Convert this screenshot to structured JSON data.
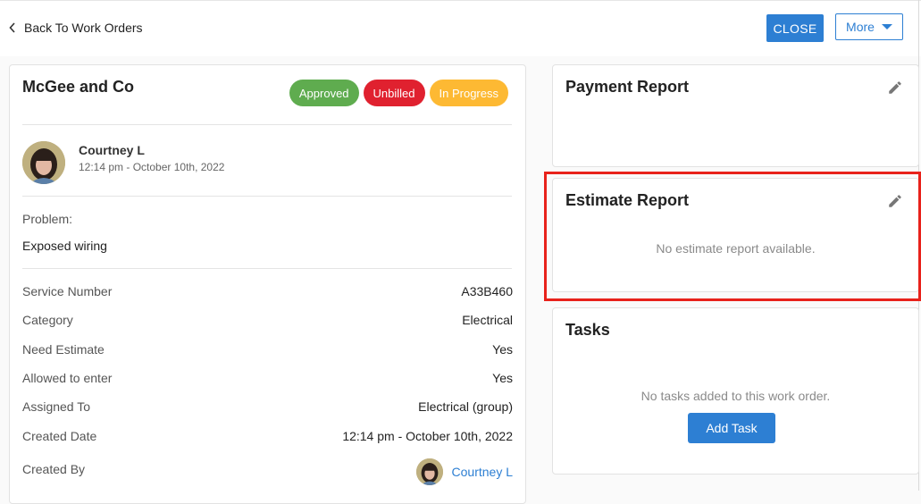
{
  "header": {
    "back_label": "Back To Work Orders",
    "close_label": "CLOSE",
    "more_label": "More"
  },
  "work_order": {
    "title": "McGee and Co",
    "badges": [
      {
        "label": "Approved",
        "color": "#5fac4f"
      },
      {
        "label": "Unbilled",
        "color": "#e0212f"
      },
      {
        "label": "In Progress",
        "color": "#fdb933"
      }
    ],
    "author": {
      "name": "Courtney L",
      "time": "12:14 pm - October 10th, 2022"
    },
    "problem_label": "Problem:",
    "problem_text": "Exposed wiring",
    "details": [
      {
        "label": "Service Number",
        "value": "A33B460"
      },
      {
        "label": "Category",
        "value": "Electrical"
      },
      {
        "label": "Need Estimate",
        "value": "Yes"
      },
      {
        "label": "Allowed to enter",
        "value": "Yes"
      },
      {
        "label": "Assigned To",
        "value": "Electrical (group)"
      },
      {
        "label": "Created Date",
        "value": "12:14 pm - October 10th, 2022"
      }
    ],
    "created_by_label": "Created By",
    "created_by_name": "Courtney L"
  },
  "payment_report": {
    "title": "Payment Report"
  },
  "estimate_report": {
    "title": "Estimate Report",
    "empty_text": "No estimate report available."
  },
  "tasks": {
    "title": "Tasks",
    "empty_text": "No tasks added to this work order.",
    "add_label": "Add Task"
  },
  "colors": {
    "accent": "#2d7fd3",
    "highlight": "#e8221b"
  },
  "icons": [
    "chevron-left-icon",
    "caret-down-icon",
    "pencil-icon"
  ]
}
